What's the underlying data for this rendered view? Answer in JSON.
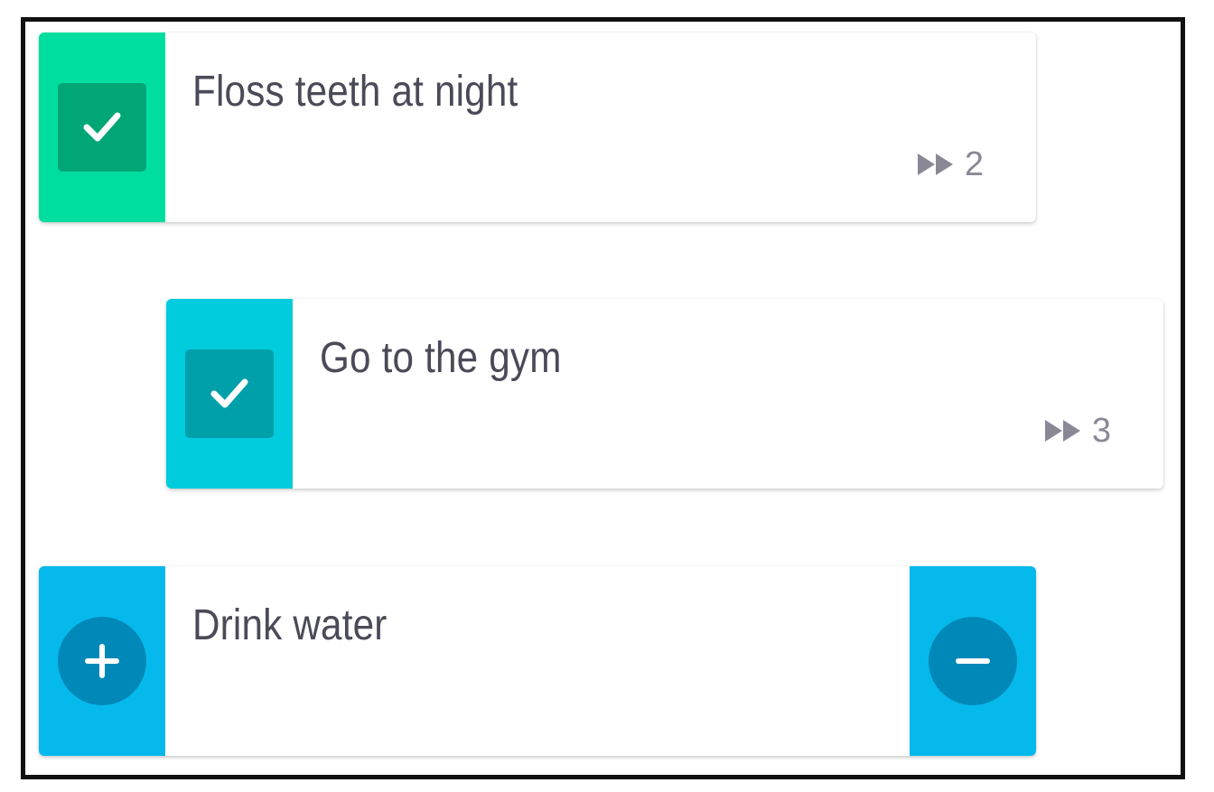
{
  "colors": {
    "floss_accent": "#00de9f",
    "floss_button": "#00a676",
    "gym_accent": "#00ccdd",
    "gym_button": "#00a0ab",
    "water_accent": "#06b9ed",
    "water_button": "#0089b8",
    "text": "#4a4a58",
    "muted": "#8b8896"
  },
  "habits": [
    {
      "title": "Floss teeth at night",
      "type": "checkbox",
      "checked": true,
      "check_icon": "checkmark-icon",
      "streak_icon": "fast-forward-icon",
      "streak_count": "2"
    },
    {
      "title": "Go to the gym",
      "type": "checkbox",
      "checked": true,
      "check_icon": "checkmark-icon",
      "streak_icon": "fast-forward-icon",
      "streak_count": "3"
    },
    {
      "title": "Drink water",
      "type": "counter",
      "increment_icon": "plus-icon",
      "decrement_icon": "minus-icon"
    }
  ]
}
